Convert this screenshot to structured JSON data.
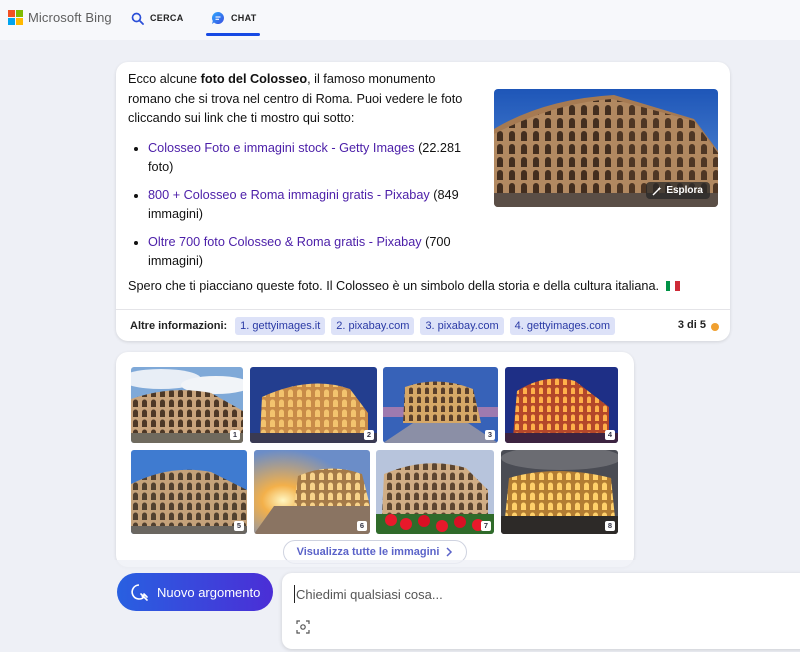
{
  "header": {
    "logo_text": "Microsoft Bing",
    "tabs": [
      {
        "label": "CERCA",
        "icon": "search-icon",
        "active": false
      },
      {
        "label": "CHAT",
        "icon": "chat-bubble-icon",
        "active": true
      }
    ]
  },
  "answer": {
    "intro_before": "Ecco alcune ",
    "intro_bold": "foto del Colosseo",
    "intro_after": ", il famoso monumento romano che si trova nel centro di Roma. Puoi vedere le foto cliccando sui link che ti mostro qui sotto:",
    "links": [
      {
        "text": "Colosseo Foto e immagini stock - Getty Images",
        "suffix": " (22.281 foto)"
      },
      {
        "text": "800 + Colosseo e Roma immagini gratis - Pixabay",
        "suffix": " (849 immagini)"
      },
      {
        "text": "Oltre 700 foto Colosseo & Roma gratis - Pixabay",
        "suffix": " (700 immagini)"
      }
    ],
    "closing": "Spero che ti piacciano queste foto. Il Colosseo è un simbolo della storia e della cultura italiana.",
    "preview_button": "Esplora",
    "info_label": "Altre informazioni:",
    "sources": [
      "1. gettyimages.it",
      "2. pixabay.com",
      "3. pixabay.com",
      "4. gettyimages.com"
    ],
    "counter": "3 di 5"
  },
  "images": {
    "thumbnails": [
      "1",
      "2",
      "3",
      "4",
      "5",
      "6",
      "7",
      "8"
    ],
    "view_all_label": "Visualizza tutte le immagini"
  },
  "composer": {
    "new_topic_label": "Nuovo argomento",
    "placeholder": "Chiedimi qualsiasi cosa..."
  },
  "colors": {
    "accent": "#174ae4",
    "link": "#4b1ea8",
    "chip_bg": "#dde2f8",
    "new_topic_gradient_start": "#2860e1",
    "new_topic_gradient_end": "#4b2ed6"
  }
}
